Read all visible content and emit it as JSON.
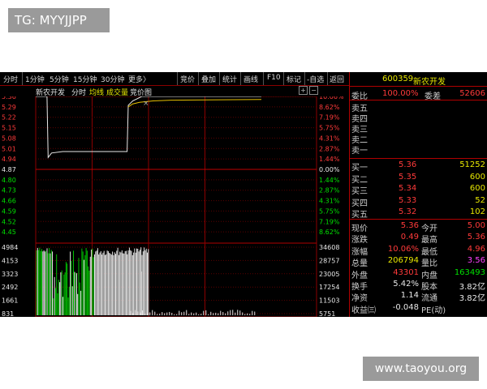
{
  "watermarks": {
    "top_left": "TG: MYYJJPP",
    "bottom_right": "www.taoyou.org"
  },
  "toolbar": {
    "tabs": [
      "分时",
      "1分钟",
      "5分钟",
      "15分钟",
      "30分钟",
      "更多〉"
    ],
    "actions": [
      "竞价",
      "叠加",
      "统计",
      "画线",
      "F10",
      "标记",
      "-自选",
      "返回"
    ]
  },
  "chart_toolbar": {
    "stock_name": "新农开发",
    "mode": "分时",
    "avg": "均线",
    "volume": "成交量",
    "auction": "竞价图"
  },
  "chart_data": {
    "type": "line",
    "price_ticks": [
      "5.36",
      "5.29",
      "5.22",
      "5.15",
      "5.08",
      "5.01",
      "4.94",
      "4.87",
      "4.80",
      "4.73",
      "4.66",
      "4.59",
      "4.52",
      "4.45"
    ],
    "pct_ticks": [
      "10.06%",
      "8.62%",
      "7.19%",
      "5.75%",
      "4.31%",
      "2.87%",
      "1.44%",
      "0.00%",
      "1.44%",
      "2.87%",
      "4.31%",
      "5.75%",
      "7.19%",
      "8.62%"
    ],
    "prev_close": 4.87,
    "ylim": [
      4.38,
      5.36
    ],
    "vol_left_ticks": [
      "4984",
      "4153",
      "3323",
      "2492",
      "1661",
      "831"
    ],
    "vol_right_ticks": [
      "34608",
      "28757",
      "23005",
      "17254",
      "11503",
      "5751"
    ],
    "price_series": [
      {
        "t": 0,
        "p": 5.36
      },
      {
        "t": 0.05,
        "p": 5.36
      },
      {
        "t": 0.055,
        "p": 4.95
      },
      {
        "t": 0.07,
        "p": 4.98
      },
      {
        "t": 0.12,
        "p": 4.99
      },
      {
        "t": 0.2,
        "p": 4.99
      },
      {
        "t": 0.28,
        "p": 4.99
      },
      {
        "t": 0.36,
        "p": 4.99
      },
      {
        "t": 0.405,
        "p": 4.99
      },
      {
        "t": 0.41,
        "p": 5.3
      },
      {
        "t": 0.43,
        "p": 5.33
      },
      {
        "t": 0.47,
        "p": 5.36
      },
      {
        "t": 1.0,
        "p": 5.36
      }
    ],
    "avg_series": [
      {
        "t": 0.41,
        "p": 5.29
      },
      {
        "t": 0.43,
        "p": 5.31
      },
      {
        "t": 0.46,
        "p": 5.32
      },
      {
        "t": 0.52,
        "p": 5.33
      },
      {
        "t": 0.6,
        "p": 5.335
      },
      {
        "t": 1.0,
        "p": 5.34
      }
    ]
  },
  "quote": {
    "code": "600359",
    "name": "新农开发",
    "weibi_label": "委比",
    "weibi": "100.00%",
    "weicha_label": "委差",
    "weicha": "52606",
    "asks": [
      {
        "label": "卖五"
      },
      {
        "label": "卖四"
      },
      {
        "label": "卖三"
      },
      {
        "label": "卖二"
      },
      {
        "label": "卖一"
      }
    ],
    "bids": [
      {
        "label": "买一",
        "price": "5.36",
        "vol": "51252"
      },
      {
        "label": "买二",
        "price": "5.35",
        "vol": "600"
      },
      {
        "label": "买三",
        "price": "5.34",
        "vol": "600"
      },
      {
        "label": "买四",
        "price": "5.33",
        "vol": "52"
      },
      {
        "label": "买五",
        "price": "5.32",
        "vol": "102"
      }
    ],
    "stats": [
      {
        "l1": "现价",
        "v1": "5.36",
        "l2": "今开",
        "v2": "5.00",
        "c1": "red",
        "c2": "red"
      },
      {
        "l1": "涨跌",
        "v1": "0.49",
        "l2": "最高",
        "v2": "5.36",
        "c1": "red",
        "c2": "red"
      },
      {
        "l1": "涨幅",
        "v1": "10.06%",
        "l2": "最低",
        "v2": "4.96",
        "c1": "red",
        "c2": "red"
      },
      {
        "l1": "总量",
        "v1": "206794",
        "l2": "量比",
        "v2": "3.56",
        "c1": "yel",
        "c2": "mag"
      },
      {
        "l1": "外盘",
        "v1": "43301",
        "l2": "内盘",
        "v2": "163493",
        "c1": "red",
        "c2": "grn"
      },
      {
        "l1": "换手",
        "v1": "5.42%",
        "l2": "股本",
        "v2": "3.82亿",
        "c1": "wht",
        "c2": "wht"
      },
      {
        "l1": "净资",
        "v1": "1.14",
        "l2": "流通",
        "v2": "3.82亿",
        "c1": "wht",
        "c2": "wht"
      },
      {
        "l1": "收益㈢",
        "v1": "-0.048",
        "l2": "PE(动)",
        "v2": "",
        "c1": "wht",
        "c2": "wht"
      }
    ]
  }
}
